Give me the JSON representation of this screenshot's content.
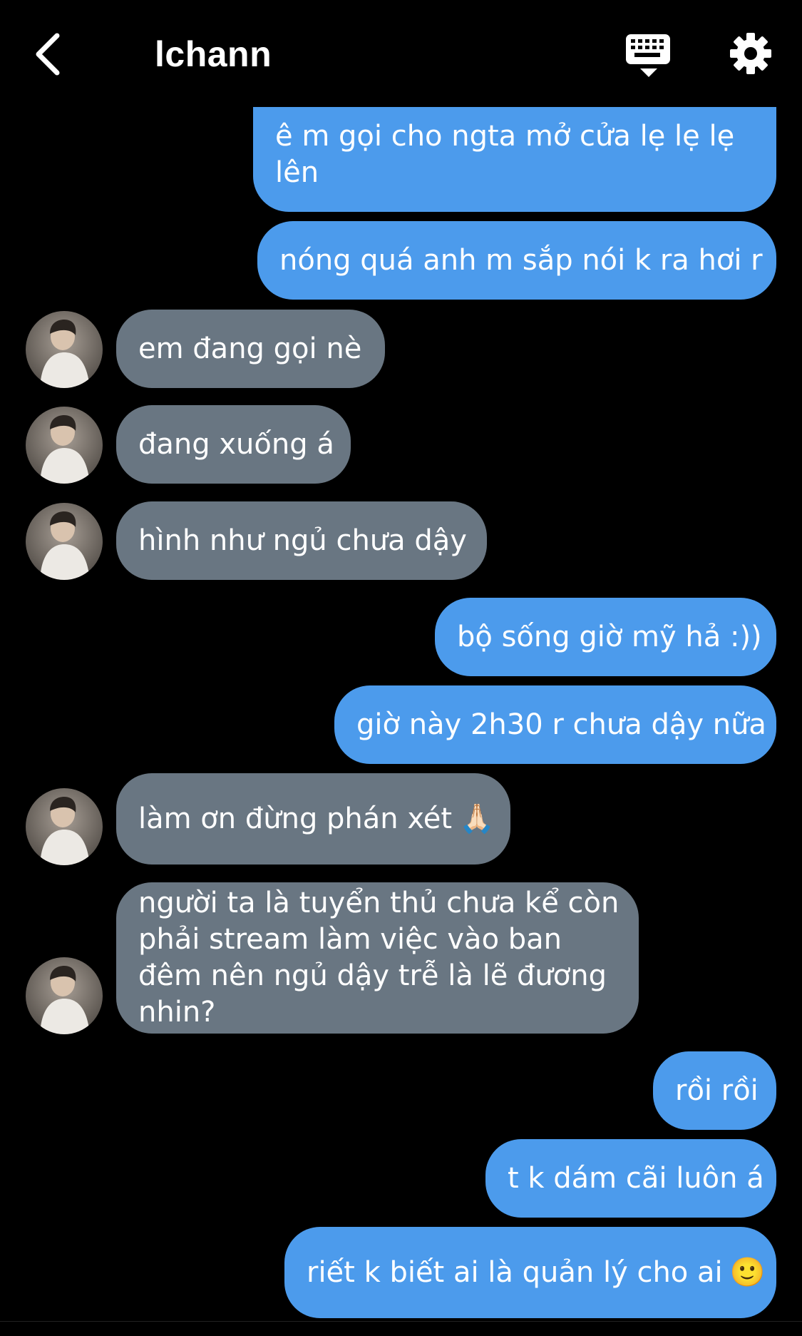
{
  "header": {
    "title": "lchann",
    "back_icon": "chevron-left-icon",
    "keyboard_icon": "keyboard-icon",
    "settings_icon": "gear-icon"
  },
  "colors": {
    "background": "#000000",
    "sent_bubble": "#4c9bec",
    "received_bubble": "#697682",
    "text": "#ffffff"
  },
  "messages": [
    {
      "direction": "sent",
      "text": "ê m gọi cho ngta mở cửa lẹ lẹ lẹ lên"
    },
    {
      "direction": "sent",
      "text": "nóng quá anh m sắp nói k ra hơi r"
    },
    {
      "direction": "received",
      "text": "em đang gọi nè"
    },
    {
      "direction": "received",
      "text": "đang xuống á"
    },
    {
      "direction": "received",
      "text": "hình như ngủ chưa dậy"
    },
    {
      "direction": "sent",
      "text": "bộ sống giờ mỹ hả :))"
    },
    {
      "direction": "sent",
      "text": "giờ này 2h30 r chưa dậy nữa"
    },
    {
      "direction": "received",
      "text": "làm ơn đừng phán xét",
      "emoji": "🙏🏻"
    },
    {
      "direction": "received",
      "text": "người ta là tuyển thủ chưa kể còn phải stream làm việc vào ban đêm nên ngủ dậy trễ là lẽ đương nhin?"
    },
    {
      "direction": "sent",
      "text": "rồi rồi"
    },
    {
      "direction": "sent",
      "text": "t k dám cãi luôn á"
    },
    {
      "direction": "sent",
      "text": "riết k biết ai là quản lý cho ai",
      "emoji": "🙂"
    }
  ]
}
